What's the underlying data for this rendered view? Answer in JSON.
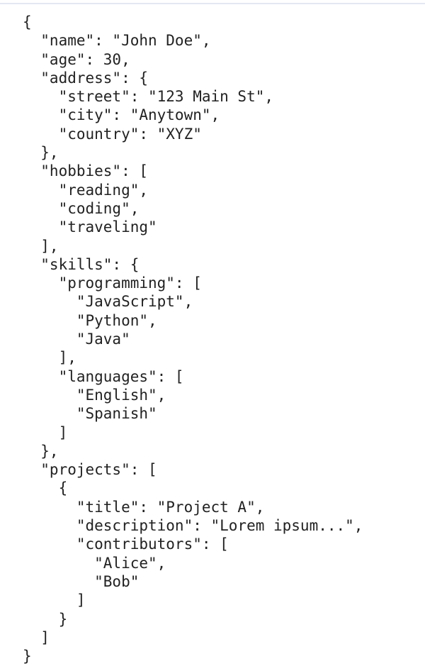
{
  "code": {
    "lines": [
      "{",
      "  \"name\": \"John Doe\",",
      "  \"age\": 30,",
      "  \"address\": {",
      "    \"street\": \"123 Main St\",",
      "    \"city\": \"Anytown\",",
      "    \"country\": \"XYZ\"",
      "  },",
      "  \"hobbies\": [",
      "    \"reading\",",
      "    \"coding\",",
      "    \"traveling\"",
      "  ],",
      "  \"skills\": {",
      "    \"programming\": [",
      "      \"JavaScript\",",
      "      \"Python\",",
      "      \"Java\"",
      "    ],",
      "    \"languages\": [",
      "      \"English\",",
      "      \"Spanish\"",
      "    ]",
      "  },",
      "  \"projects\": [",
      "    {",
      "      \"title\": \"Project A\",",
      "      \"description\": \"Lorem ipsum...\",",
      "      \"contributors\": [",
      "        \"Alice\",",
      "        \"Bob\"",
      "      ]",
      "    }",
      "  ]",
      "}"
    ]
  }
}
